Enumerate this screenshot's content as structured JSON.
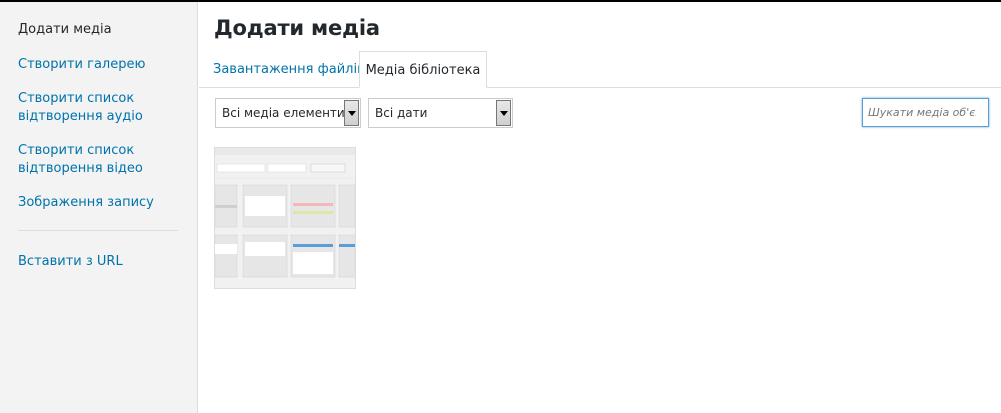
{
  "sidebar": {
    "items": [
      {
        "label": "Додати медіа"
      },
      {
        "label": "Створити галерею"
      },
      {
        "label": "Створити список відтворення аудіо"
      },
      {
        "label": "Створити список відтворення відео"
      },
      {
        "label": "Зображення запису"
      },
      {
        "label": "Вставити з URL"
      }
    ]
  },
  "main": {
    "title": "Додати медіа",
    "tabs": [
      {
        "label": "Завантаження файлів"
      },
      {
        "label": "Медіа бібліотека"
      }
    ],
    "filters": {
      "type_selected": "Всі медіа елементи",
      "date_selected": "Всі дати"
    },
    "search": {
      "placeholder": "Шукати медіа об'єкт"
    }
  },
  "colors": {
    "link": "#0073aa",
    "text": "#23282d",
    "sidebar_bg": "#f3f3f3",
    "focus": "#5b9dd9"
  }
}
